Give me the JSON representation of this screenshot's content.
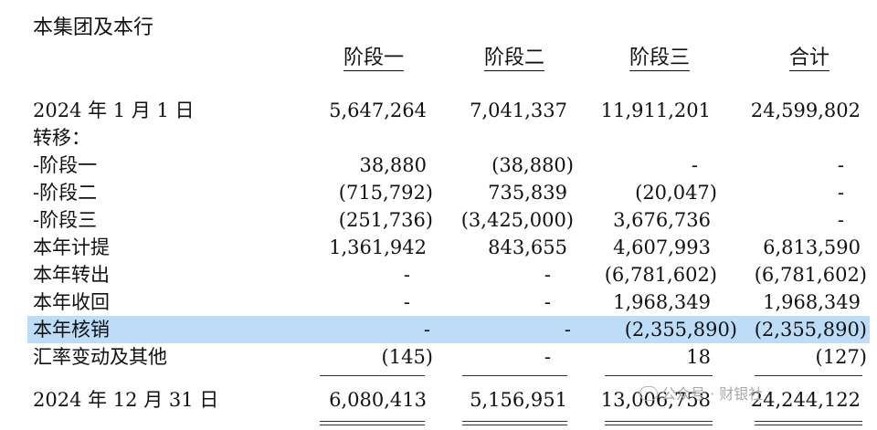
{
  "title": "本集团及本行",
  "columns": [
    "阶段一",
    "阶段二",
    "阶段三",
    "合计"
  ],
  "rows": [
    {
      "label": "2024 年 1 月 1 日",
      "values": [
        "5,647,264",
        "7,041,337",
        "11,911,201",
        "24,599,802"
      ]
    },
    {
      "label": "转移：",
      "values": [
        "",
        "",
        "",
        ""
      ]
    },
    {
      "label": "-阶段一",
      "values": [
        "38,880",
        "(38,880)",
        "-",
        "-"
      ]
    },
    {
      "label": "-阶段二",
      "values": [
        "(715,792)",
        "735,839",
        "(20,047)",
        "-"
      ]
    },
    {
      "label": "-阶段三",
      "values": [
        "(251,736)",
        "(3,425,000)",
        "3,676,736",
        "-"
      ]
    },
    {
      "label": "本年计提",
      "values": [
        "1,361,942",
        "843,655",
        "4,607,993",
        "6,813,590"
      ]
    },
    {
      "label": "本年转出",
      "values": [
        "-",
        "-",
        "(6,781,602)",
        "(6,781,602)"
      ]
    },
    {
      "label": "本年收回",
      "values": [
        "-",
        "-",
        "1,968,349",
        "1,968,349"
      ]
    },
    {
      "label": "本年核销",
      "values": [
        "-",
        "-",
        "(2,355,890)",
        "(2,355,890)"
      ],
      "highlighted": true
    },
    {
      "label": "汇率变动及其他",
      "values": [
        "(145)",
        "-",
        "18",
        "(127)"
      ]
    },
    {
      "label": "2024 年 12 月 31 日",
      "values": [
        "6,080,413",
        "5,156,951",
        "13,006,758",
        "24,244,122"
      ]
    }
  ],
  "watermark": "公众号 · 财银社",
  "colors": {
    "highlight": "#bcdcf7",
    "text": "#111111"
  }
}
